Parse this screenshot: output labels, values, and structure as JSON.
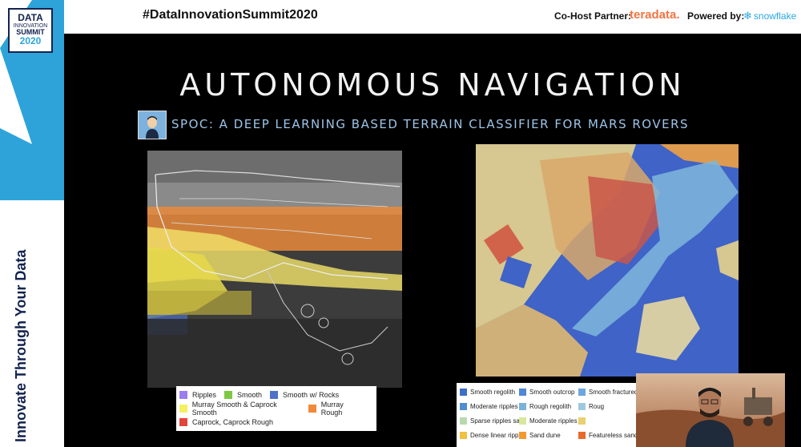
{
  "header": {
    "hashtag": "#DataInnovationSummit2020",
    "cohost_label": "Co-Host Partner:",
    "cohost_brand": "teradata.",
    "powered_label": "Powered by:",
    "powered_brand": "snowflake"
  },
  "logo": {
    "line1": "DATA",
    "line2": "INNOVATION",
    "line3": "SUMMIT",
    "line4": "2020"
  },
  "side_text": "Innovate Through Your Data",
  "slide": {
    "title": "AUTONOMOUS NAVIGATION",
    "subtitle": "SPOC: A DEEP LEARNING BASED TERRAIN CLASSIFIER FOR MARS ROVERS",
    "legend_left": [
      [
        {
          "label": "Ripples",
          "color": "#9b7ef0"
        },
        {
          "label": "Smooth",
          "color": "#7fc743"
        },
        {
          "label": "Smooth w/ Rocks",
          "color": "#4f72c9"
        }
      ],
      [
        {
          "label": "Murray Smooth & Caprock Smooth",
          "color": "#f5f060"
        },
        {
          "label": "Murray Rough",
          "color": "#f08a3a"
        }
      ],
      [
        {
          "label": "Caprock, Caprock Rough",
          "color": "#e0463a"
        }
      ]
    ],
    "legend_right": [
      [
        {
          "label": "Smooth regolith",
          "color": "#3d6ec9"
        },
        {
          "label": "Smooth outcrop",
          "color": "#4f86d6"
        },
        {
          "label": "Smooth fractured ou",
          "color": "#6ea6e0"
        }
      ],
      [
        {
          "label": "Moderate ripples firm substrate",
          "color": "#4d8fd0"
        },
        {
          "label": "Rough regolith",
          "color": "#79b3d8"
        },
        {
          "label": "Roug",
          "color": "#9fc8e0"
        }
      ],
      [
        {
          "label": "Sparse ripples sandy substrate",
          "color": "#b9d8b0"
        },
        {
          "label": "Moderate ripples sandy subs",
          "color": "#d8e79a"
        },
        {
          "label": "",
          "color": "#e9d070"
        }
      ],
      [
        {
          "label": "Dense linear ripples",
          "color": "#f0c040"
        },
        {
          "label": "Sand dune",
          "color": "#f29a30"
        },
        {
          "label": "Featureless sand",
          "color": "#e86a2a"
        }
      ]
    ]
  }
}
